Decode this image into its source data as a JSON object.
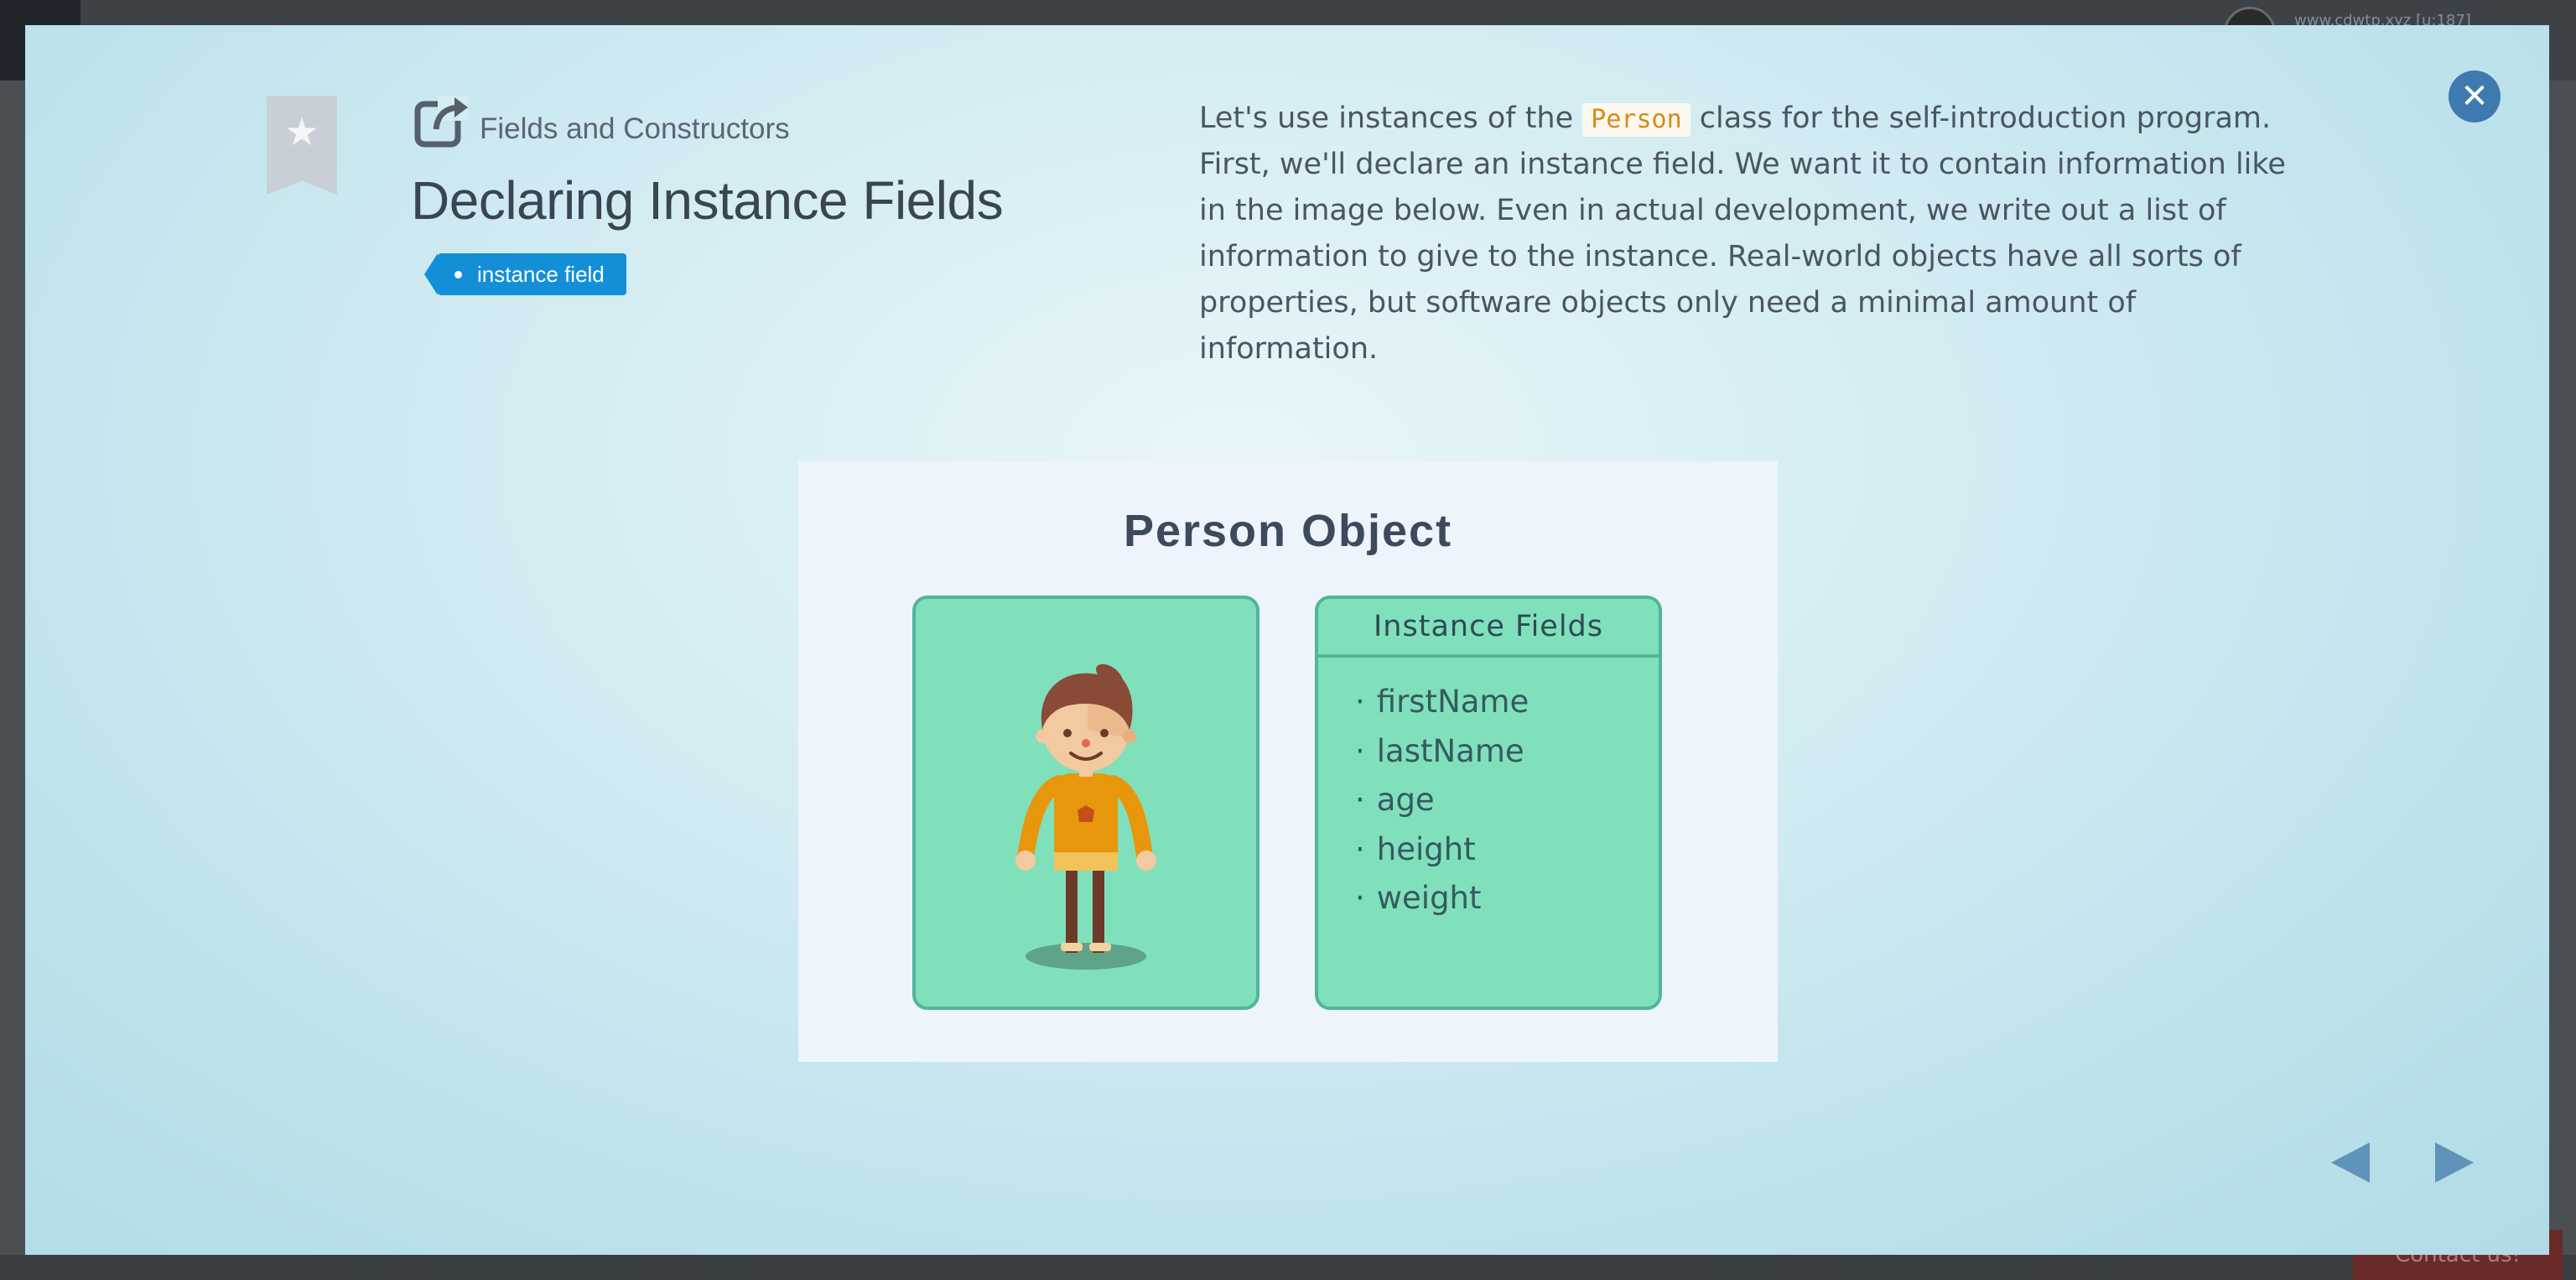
{
  "background": {
    "url_text": "www.cdwtp.xyz [u:187]",
    "contact_label": "Contact us!"
  },
  "modal": {
    "section": "Fields and Constructors",
    "title": "Declaring Instance Fields",
    "tag": "instance field",
    "description": {
      "before_code": "Let's use instances of the ",
      "code": "Person",
      "after_code": " class for the self-introduction program. First, we'll declare an instance field. We want it to contain information like in the image below. Even in actual development, we write out a list of information to give to the instance. Real-world objects have all sorts of properties, but software objects only need a minimal amount of information."
    }
  },
  "figure": {
    "title": "Person Object",
    "fields_header": "Instance Fields",
    "fields": [
      "firstName",
      "lastName",
      "age",
      "height",
      "weight"
    ]
  },
  "colors": {
    "accent_blue": "#138fd8",
    "card_green": "#80e0bb",
    "code_orange": "#d88a17",
    "close_blue": "#3e7ab0",
    "arrow_blue": "#5f93b8"
  },
  "icons": [
    "bookmark-icon",
    "star-icon",
    "external-link-icon",
    "close-icon",
    "prev-arrow-icon",
    "next-arrow-icon"
  ]
}
